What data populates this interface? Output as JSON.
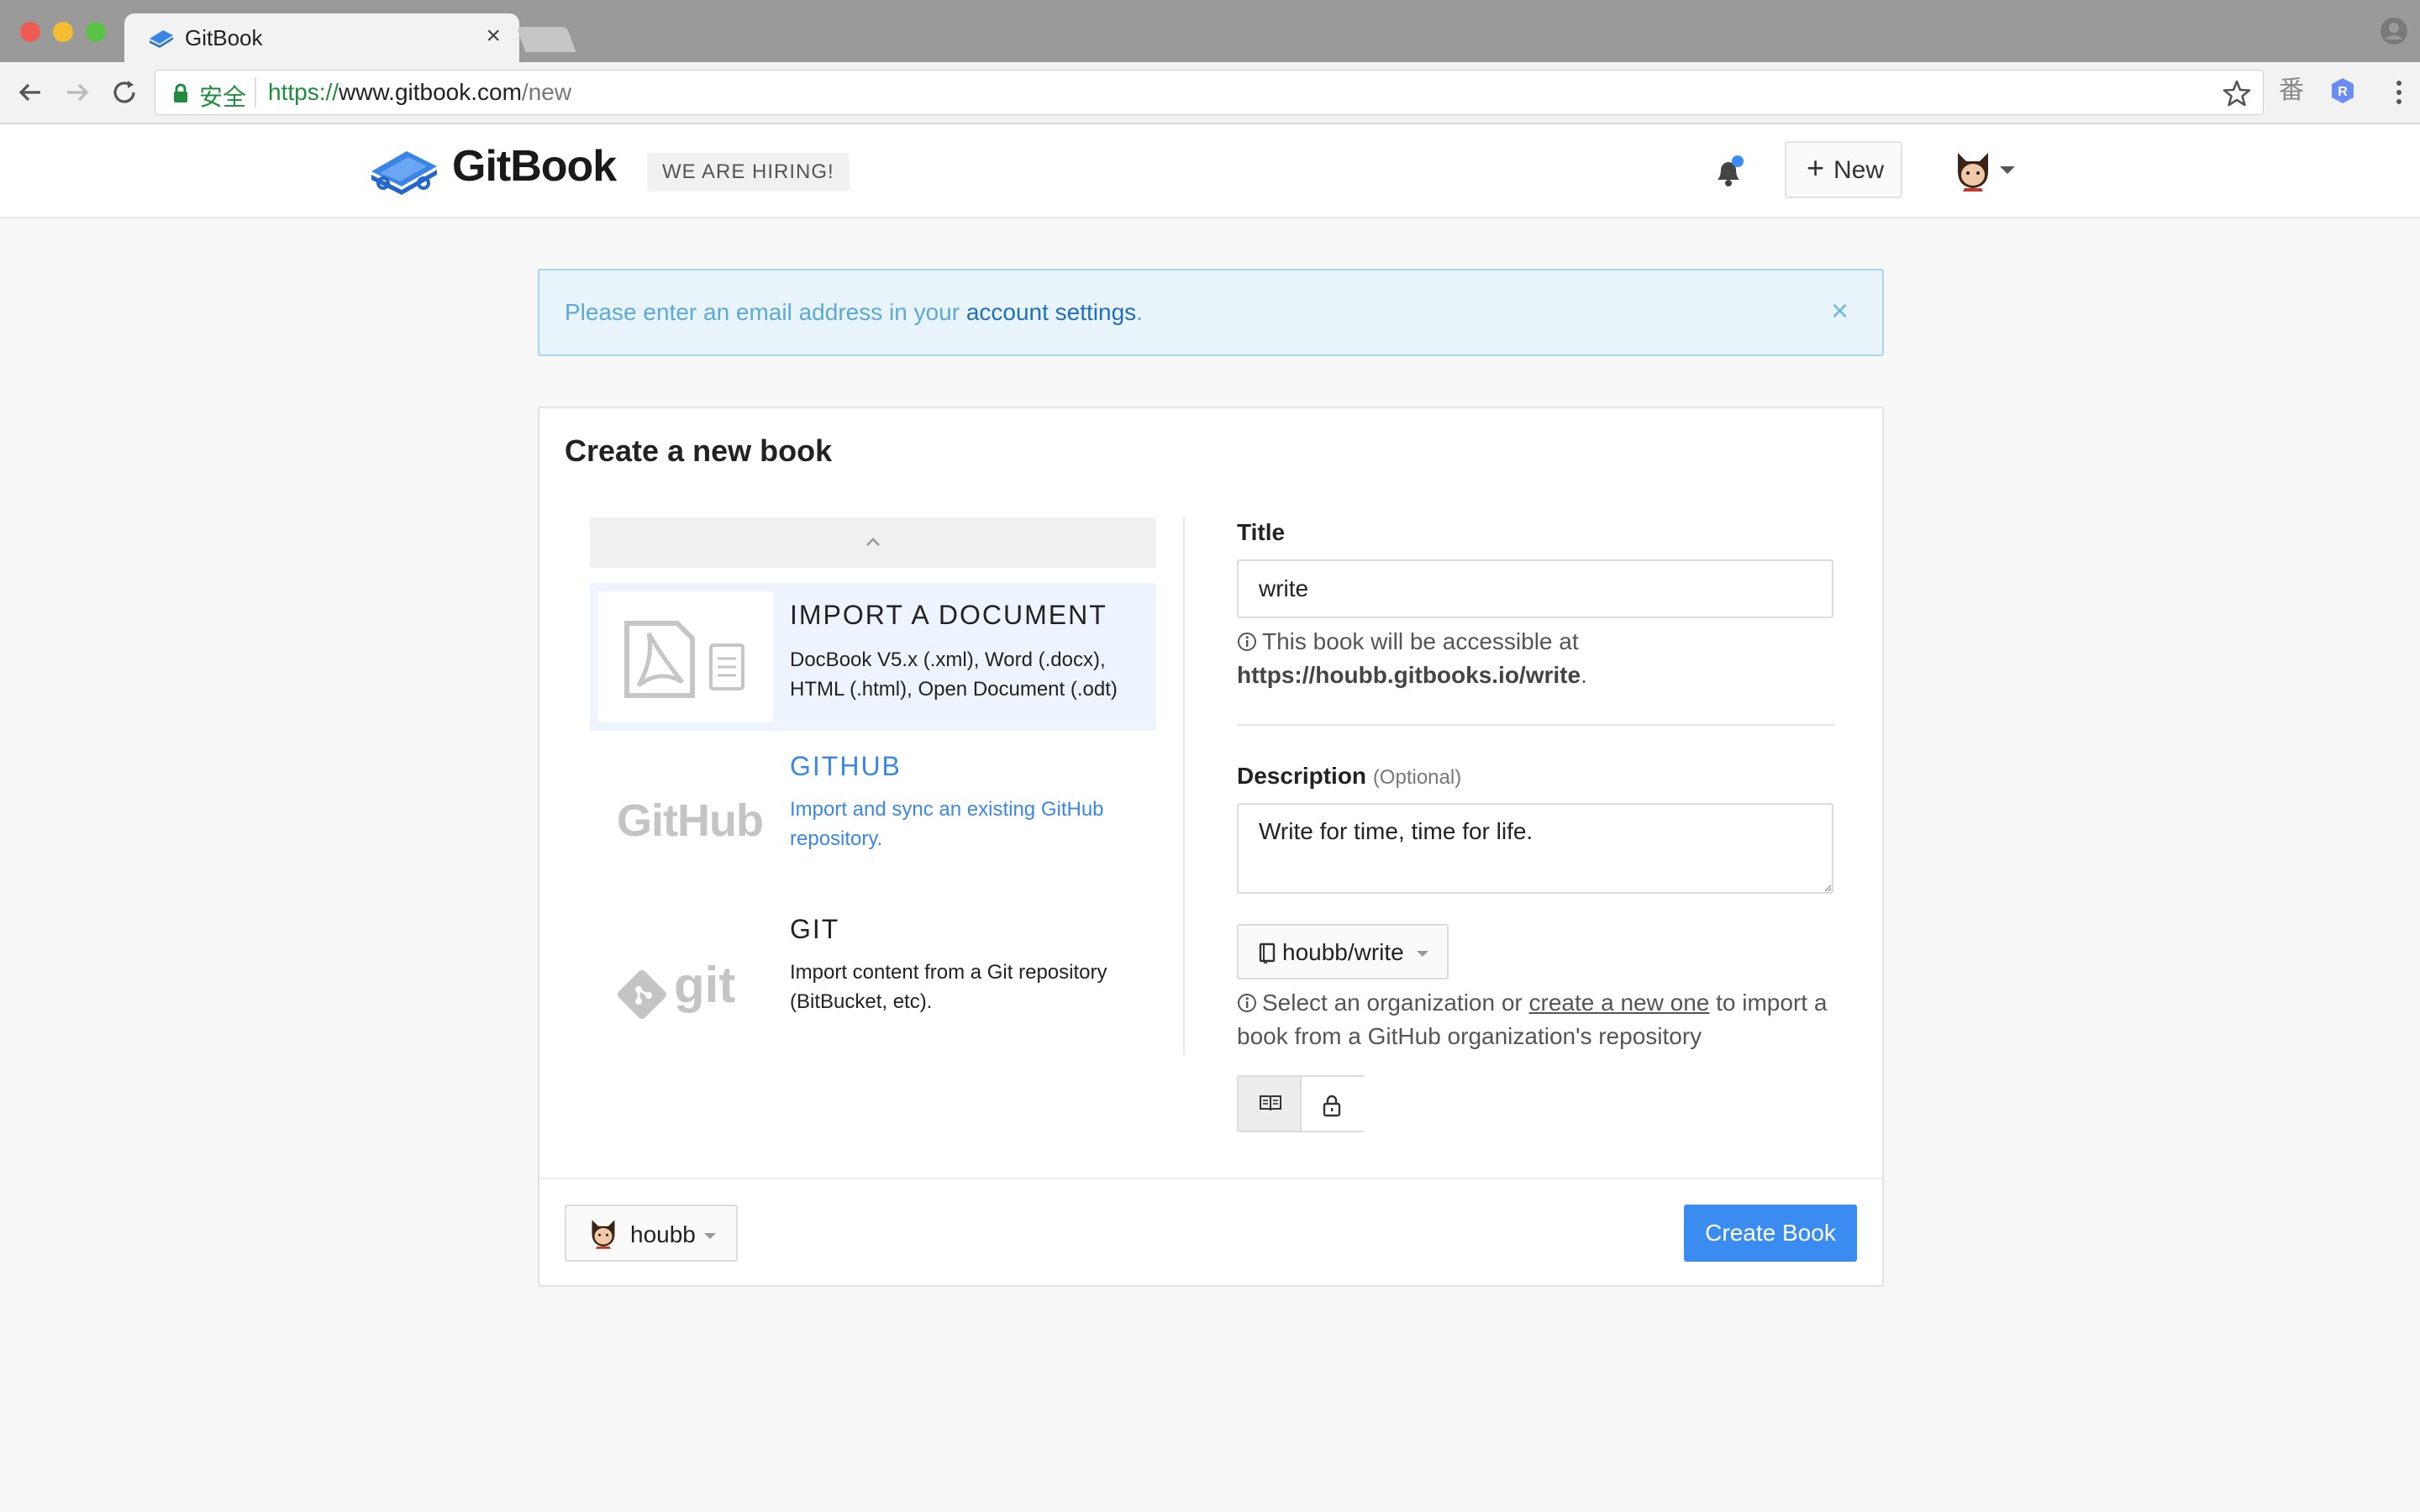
{
  "browser": {
    "tab_title": "GitBook",
    "tab_close": "×",
    "secure_label": "安全",
    "url_scheme": "https://",
    "url_host": "www.gitbook.com",
    "url_path": "/new",
    "ext_label": "番",
    "ext_badge": "R"
  },
  "header": {
    "logo_text": "GitBook",
    "hiring_badge": "WE ARE HIRING!",
    "new_plus": "+",
    "new_label": "New"
  },
  "alert": {
    "text_before": "Please enter an email address in your ",
    "link_text": "account settings",
    "text_after": ".",
    "close": "×"
  },
  "card": {
    "title": "Create a new book",
    "sources": [
      {
        "name": "IMPORT A DOCUMENT",
        "description": "DocBook V5.x (.xml), Word (.docx), HTML (.html), Open Document (.odt)",
        "logo": "pdf-document-icon"
      },
      {
        "name": "GITHUB",
        "description": "Import and sync an existing GitHub repository.",
        "logo_text": "GitHub"
      },
      {
        "name": "GIT",
        "description": "Import content from a Git repository (BitBucket, etc).",
        "logo_text": "git"
      }
    ],
    "title_label": "Title",
    "title_value": "write",
    "title_hint": "This book will be accessible at",
    "title_url": "https://houbb.gitbooks.io/write",
    "title_url_suffix": ".",
    "description_label": "Description",
    "description_optional": "(Optional)",
    "description_value": "Write for time, time for life.",
    "repo_value": "houbb/write",
    "org_hint_before": "Select an organization or ",
    "org_hint_link": "create a new one",
    "org_hint_after": " to import a book from a GitHub organization's repository",
    "owner_value": "houbb",
    "create_button": "Create Book"
  },
  "colors": {
    "primary": "#3b8cf1",
    "alert_bg": "#e8f4fa",
    "alert_text": "#5aa9d6",
    "logo_blue": "#3a84e5"
  }
}
